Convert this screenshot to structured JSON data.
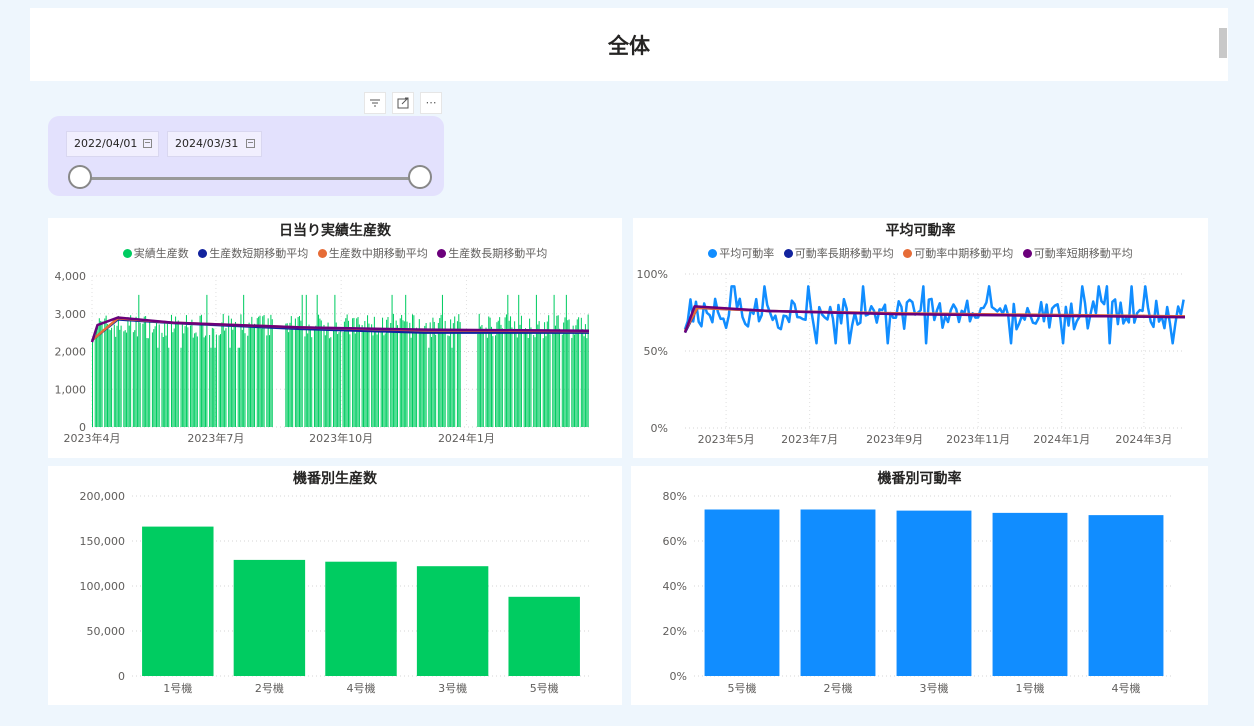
{
  "header": {
    "title": "全体"
  },
  "toolbar": {
    "filter_icon": "filter-icon",
    "focus_icon": "focus-mode-icon",
    "more_label": "⋯"
  },
  "slicer": {
    "start_date": "2022/04/01",
    "end_date": "2024/03/31",
    "calendar_icon": "calendar-icon"
  },
  "colors": {
    "green": "#00cc61",
    "blue": "#118dff",
    "navy": "#12239e",
    "orange": "#e66c37",
    "purple": "#6b007b",
    "slicer_bg": "#e3e1fd"
  },
  "panels": {
    "daily_production": {
      "title": "日当り実績生産数",
      "legend": [
        {
          "label": "実績生産数",
          "color": "#00cc61"
        },
        {
          "label": "生産数短期移動平均",
          "color": "#12239e"
        },
        {
          "label": "生産数中期移動平均",
          "color": "#e66c37"
        },
        {
          "label": "生産数長期移動平均",
          "color": "#6b007b"
        }
      ],
      "y_ticks": [
        "0",
        "1,000",
        "2,000",
        "3,000",
        "4,000"
      ],
      "x_ticks": [
        "2023年4月",
        "2023年7月",
        "2023年10月",
        "2024年1月"
      ]
    },
    "avg_utilization": {
      "title": "平均可動率",
      "legend": [
        {
          "label": "平均可動率",
          "color": "#118dff"
        },
        {
          "label": "可動率長期移動平均",
          "color": "#12239e"
        },
        {
          "label": "可動率中期移動平均",
          "color": "#e66c37"
        },
        {
          "label": "可動率短期移動平均",
          "color": "#6b007b"
        }
      ],
      "y_ticks": [
        "0%",
        "50%",
        "100%"
      ],
      "x_ticks": [
        "2023年5月",
        "2023年7月",
        "2023年9月",
        "2023年11月",
        "2024年1月",
        "2024年3月"
      ]
    },
    "machine_production": {
      "title": "機番別生産数",
      "y_ticks": [
        "0",
        "50,000",
        "100,000",
        "150,000",
        "200,000"
      ]
    },
    "machine_utilization": {
      "title": "機番別可動率",
      "y_ticks": [
        "0%",
        "20%",
        "40%",
        "60%",
        "80%"
      ]
    }
  },
  "chart_data": [
    {
      "type": "bar",
      "title": "日当り実績生産数",
      "x_range": [
        "2023-04-01",
        "2024-03-31"
      ],
      "ylim": [
        0,
        4000
      ],
      "legend_position": "top",
      "gaps": [
        [
          "2023-08-12",
          "2023-08-20"
        ],
        [
          "2023-12-28",
          "2024-01-08"
        ]
      ],
      "series": [
        {
          "name": "実績生産数",
          "kind": "daily_bars",
          "typical_range": [
            2100,
            3500
          ]
        },
        {
          "name": "生産数短期移動平均",
          "kind": "line",
          "points": [
            [
              "2023-04-01",
              2300
            ],
            [
              "2023-04-20",
              2850
            ],
            [
              "2023-06-01",
              2750
            ],
            [
              "2023-09-01",
              2600
            ],
            [
              "2023-12-01",
              2500
            ],
            [
              "2024-03-31",
              2500
            ]
          ]
        },
        {
          "name": "生産数中期移動平均",
          "kind": "line",
          "points": [
            [
              "2023-04-01",
              2300
            ],
            [
              "2023-04-20",
              2880
            ],
            [
              "2023-06-01",
              2760
            ],
            [
              "2023-09-01",
              2640
            ],
            [
              "2023-12-01",
              2560
            ],
            [
              "2024-03-31",
              2540
            ]
          ]
        },
        {
          "name": "生産数長期移動平均",
          "kind": "line",
          "points": [
            [
              "2023-04-01",
              2250
            ],
            [
              "2023-04-05",
              2700
            ],
            [
              "2023-04-20",
              2900
            ],
            [
              "2023-06-01",
              2760
            ],
            [
              "2023-09-01",
              2640
            ],
            [
              "2023-12-01",
              2580
            ],
            [
              "2024-03-31",
              2550
            ]
          ]
        }
      ]
    },
    {
      "type": "line",
      "title": "平均可動率",
      "x_range": [
        "2023-04-01",
        "2024-03-31"
      ],
      "ylim": [
        0,
        1
      ],
      "legend_position": "top",
      "series": [
        {
          "name": "平均可動率",
          "kind": "daily_line",
          "typical_range": [
            0.55,
            0.92
          ]
        },
        {
          "name": "可動率長期移動平均",
          "kind": "line",
          "points": [
            [
              "2023-04-01",
              0.62
            ],
            [
              "2023-04-10",
              0.78
            ],
            [
              "2023-06-01",
              0.76
            ],
            [
              "2023-09-01",
              0.74
            ],
            [
              "2024-03-31",
              0.72
            ]
          ]
        },
        {
          "name": "可動率中期移動平均",
          "kind": "line",
          "points": [
            [
              "2023-04-01",
              0.63
            ],
            [
              "2023-04-10",
              0.78
            ],
            [
              "2023-06-01",
              0.76
            ],
            [
              "2023-09-01",
              0.745
            ],
            [
              "2024-03-31",
              0.725
            ]
          ]
        },
        {
          "name": "可動率短期移動平均",
          "kind": "line",
          "points": [
            [
              "2023-04-01",
              0.62
            ],
            [
              "2023-04-08",
              0.79
            ],
            [
              "2023-06-01",
              0.76
            ],
            [
              "2023-09-01",
              0.74
            ],
            [
              "2024-03-31",
              0.72
            ]
          ]
        }
      ]
    },
    {
      "type": "bar",
      "title": "機番別生産数",
      "categories": [
        "1号機",
        "2号機",
        "4号機",
        "3号機",
        "5号機"
      ],
      "values": [
        166000,
        129000,
        127000,
        122000,
        88000
      ],
      "ylim": [
        0,
        200000
      ],
      "color": "#00cc61"
    },
    {
      "type": "bar",
      "title": "機番別可動率",
      "categories": [
        "5号機",
        "2号機",
        "3号機",
        "1号機",
        "4号機"
      ],
      "values": [
        0.74,
        0.74,
        0.735,
        0.725,
        0.715
      ],
      "ylim": [
        0,
        0.8
      ],
      "color": "#118dff"
    }
  ]
}
